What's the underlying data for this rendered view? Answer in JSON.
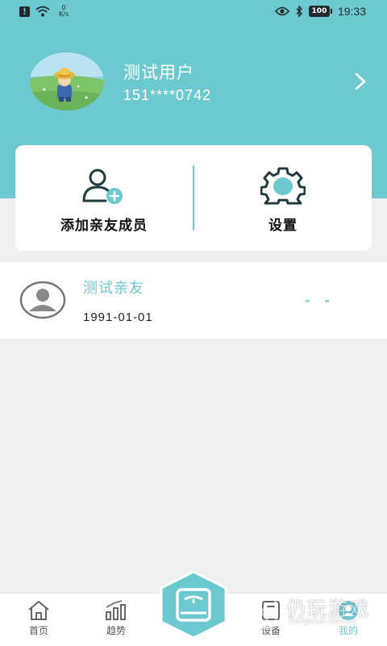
{
  "status_bar": {
    "notify_glyph": "!",
    "net_speed_value": "0",
    "net_speed_unit": "K/s",
    "battery": "100",
    "time": "19:33"
  },
  "profile": {
    "name": "测试用户",
    "phone": "151****0742"
  },
  "actions": {
    "add_member_label": "添加亲友成员",
    "settings_label": "设置"
  },
  "members": [
    {
      "name": "测试亲友",
      "birth_date": "1991-01-01",
      "value": "- -"
    }
  ],
  "tabbar": {
    "tabs": [
      {
        "label": "首页",
        "icon": "home-icon"
      },
      {
        "label": "趋势",
        "icon": "trend-icon"
      },
      {
        "label": "",
        "icon": "scale-icon"
      },
      {
        "label": "设备",
        "icon": "device-icon"
      },
      {
        "label": "我的",
        "icon": "profile-icon",
        "active": true
      }
    ]
  },
  "watermark": {
    "text": "仍玩游戏",
    "subtext": "Rengwan Games"
  },
  "colors": {
    "accent": "#6cc9cf",
    "background": "#f0f0f0",
    "card": "#ffffff",
    "icon_dark": "#1f3a3d"
  }
}
